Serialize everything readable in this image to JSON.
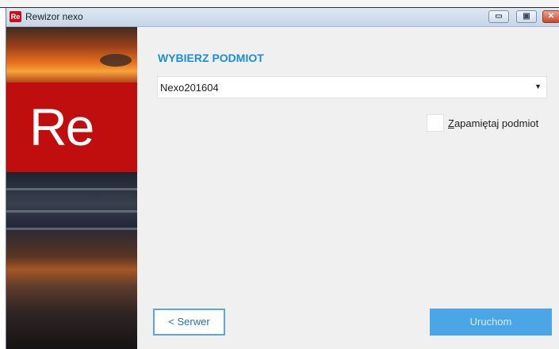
{
  "window": {
    "title": "Rewizor nexo",
    "app_icon_text": "Re",
    "controls": {
      "minimize": "▭",
      "maximize": "▣",
      "close": "✕"
    }
  },
  "sidebar": {
    "logo_text": "Re"
  },
  "main": {
    "heading": "WYBIERZ PODMIOT",
    "company_select": {
      "value": "Nexo201604",
      "arrow": "▼"
    },
    "remember": {
      "checked": false,
      "label_first_letter": "Z",
      "label_rest": "apamiętaj podmiot"
    }
  },
  "buttons": {
    "server_label": "< Serwer",
    "run_label": "Uruchom"
  },
  "colors": {
    "accent": "#1a8fd6",
    "brand_red": "#c00d0d",
    "primary_button": "#4aa6e6"
  }
}
